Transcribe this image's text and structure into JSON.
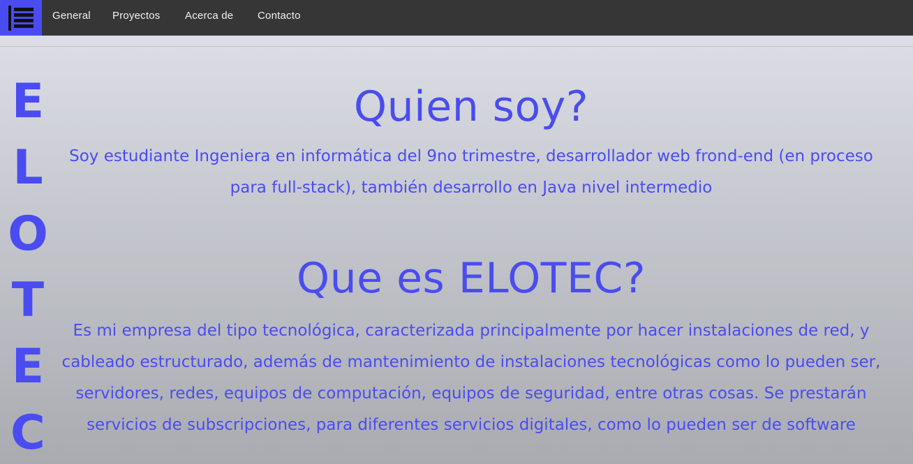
{
  "nav": {
    "logo_icon": "menu-bars-icon",
    "links": [
      "General",
      "Proyectos",
      "Acerca de",
      "Contacto"
    ],
    "colors": {
      "bar": "#363636",
      "logo_bg": "#4a4cf1",
      "text": "#f2f2f2"
    }
  },
  "brand": {
    "letters": [
      "E",
      "L",
      "O",
      "T",
      "E",
      "C"
    ]
  },
  "about": {
    "title": "Quien soy?",
    "text": "Soy estudiante Ingeniera en informática del 9no trimestre, desarrollador web frond-end (en proceso para full-stack), también desarrollo en Java nivel intermedio"
  },
  "company": {
    "title": "Que es ELOTEC?",
    "text": "Es mi empresa del tipo tecnológica, caracterizada principalmente por hacer instalaciones de red, y cableado estructurado, además de mantenimiento de instalaciones tecnológicas como lo pueden ser, servidores, redes, equipos de computación, equipos de seguridad, entre otras cosas. Se prestarán servicios de subscripciones, para diferentes servicios digitales, como lo pueden ser de software"
  },
  "accent_color": "#4a4cf1"
}
